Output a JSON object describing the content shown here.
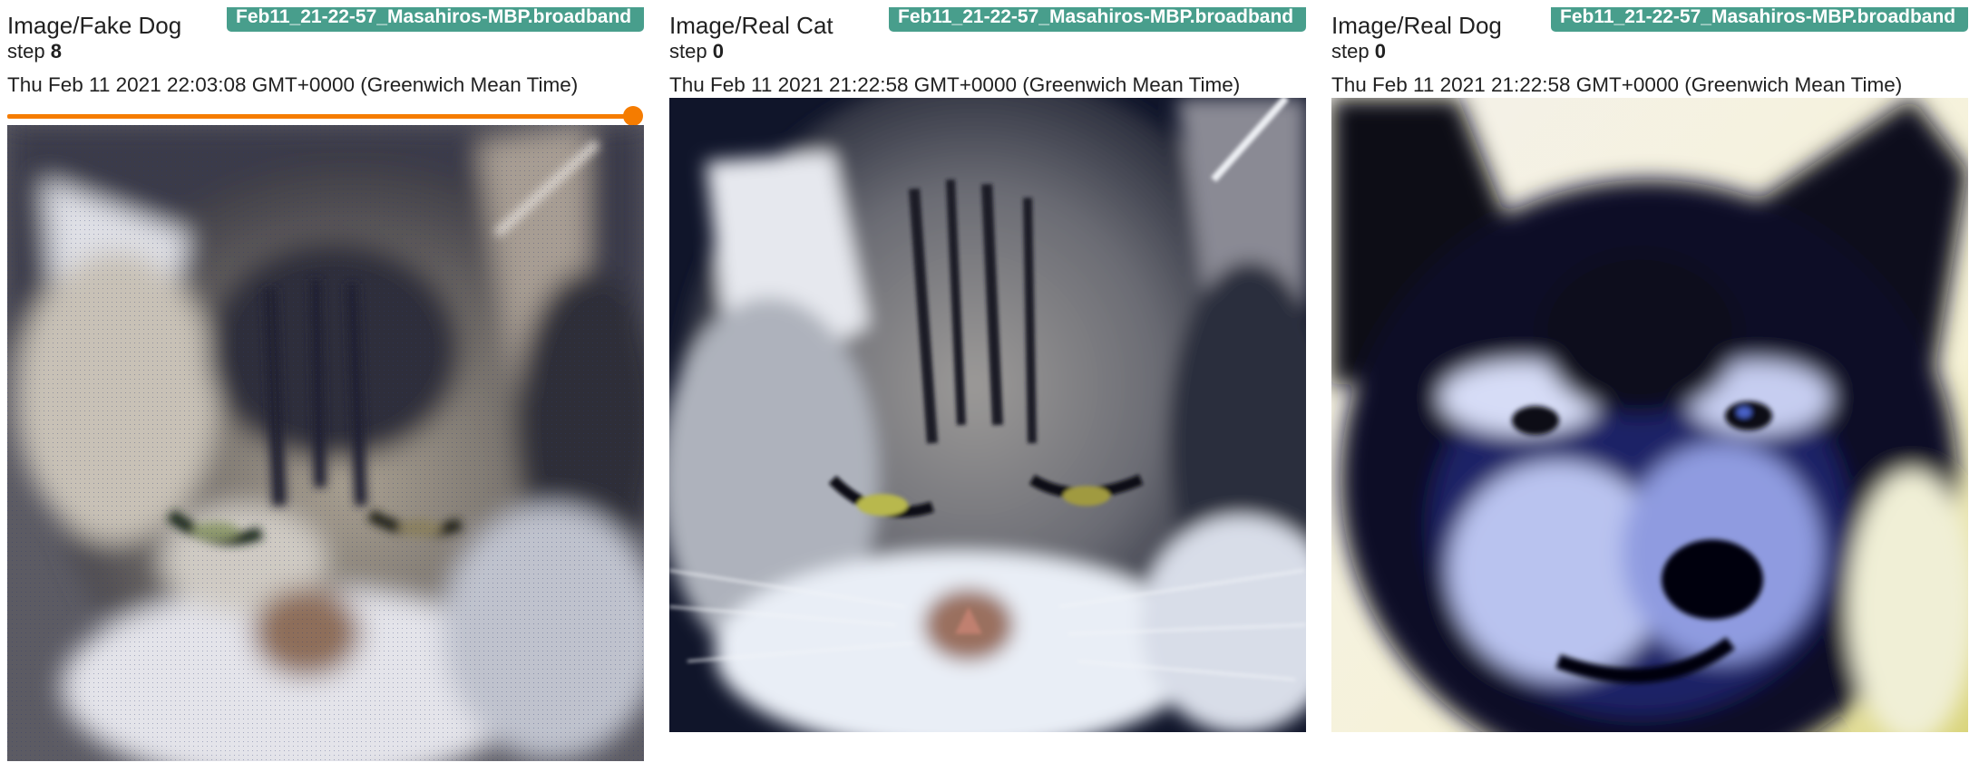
{
  "cards": [
    {
      "title": "Image/Fake Dog",
      "run": "Feb11_21-22-57_Masahiros-MBP.broadband",
      "step_label": "step",
      "step": "8",
      "timestamp": "Thu Feb 11 2021 22:03:08 GMT+0000 (Greenwich Mean Time)",
      "has_step_slider": true,
      "slider_fraction": 1.0,
      "image_subject": "generated-cat-image"
    },
    {
      "title": "Image/Real Cat",
      "run": "Feb11_21-22-57_Masahiros-MBP.broadband",
      "step_label": "step",
      "step": "0",
      "timestamp": "Thu Feb 11 2021 21:22:58 GMT+0000 (Greenwich Mean Time)",
      "has_step_slider": false,
      "image_subject": "tabby-cat-photo"
    },
    {
      "title": "Image/Real Dog",
      "run": "Feb11_21-22-57_Masahiros-MBP.broadband",
      "step_label": "step",
      "step": "0",
      "timestamp": "Thu Feb 11 2021 21:22:58 GMT+0000 (Greenwich Mean Time)",
      "has_step_slider": false,
      "image_subject": "black-dog-photo"
    }
  ],
  "colors": {
    "run_badge": "#489e8c",
    "slider": "#f57c00",
    "text": "#212121"
  }
}
